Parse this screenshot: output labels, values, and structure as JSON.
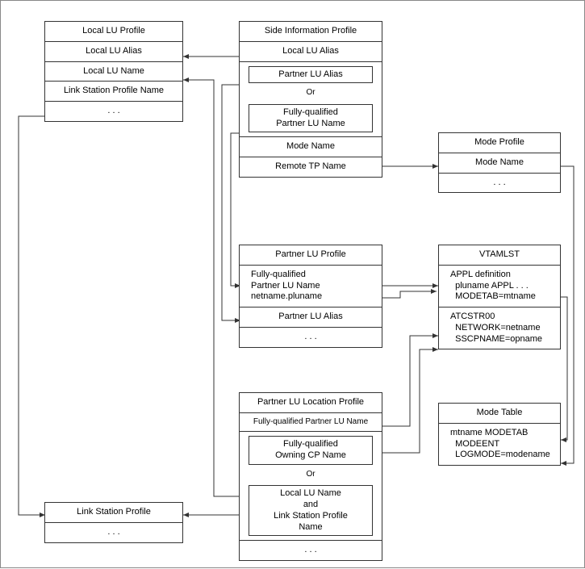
{
  "localLU": {
    "title": "Local LU Profile",
    "alias": "Local LU Alias",
    "name": "Local LU Name",
    "linkStation": "Link Station Profile Name",
    "more": ". . ."
  },
  "sideInfo": {
    "title": "Side Information Profile",
    "localLUAlias": "Local LU Alias",
    "partnerLUAlias": "Partner LU Alias",
    "or": "Or",
    "fqPartnerLU": "Fully-qualified\nPartner LU Name",
    "modeName": "Mode Name",
    "remoteTP": "Remote TP Name"
  },
  "modeProfile": {
    "title": "Mode Profile",
    "modeName": "Mode Name",
    "more": ". . ."
  },
  "partnerLU": {
    "title": "Partner LU Profile",
    "fq": "Fully-qualified\nPartner LU Name\nnetname.pluname",
    "alias": "Partner LU Alias",
    "more": ". . ."
  },
  "vtamlst": {
    "title": "VTAMLST",
    "appl": "APPL definition\n  pluname APPL . . .\n  MODETAB=mtname",
    "atc": "ATCSTR00\n  NETWORK=netname\n  SSCPNAME=opname"
  },
  "modeTable": {
    "title": "Mode Table",
    "body": "mtname MODETAB\n  MODEENT\n  LOGMODE=modename"
  },
  "partnerLoc": {
    "title": "Partner LU Location Profile",
    "fq": "Fully-qualified Partner LU Name",
    "owningCP": "Fully-qualified\nOwning CP Name",
    "or": "Or",
    "localAndLink": "Local LU Name\nand\nLink Station Profile\nName",
    "more": ". . ."
  },
  "linkStation": {
    "title": "Link Station Profile",
    "more": ". . ."
  }
}
